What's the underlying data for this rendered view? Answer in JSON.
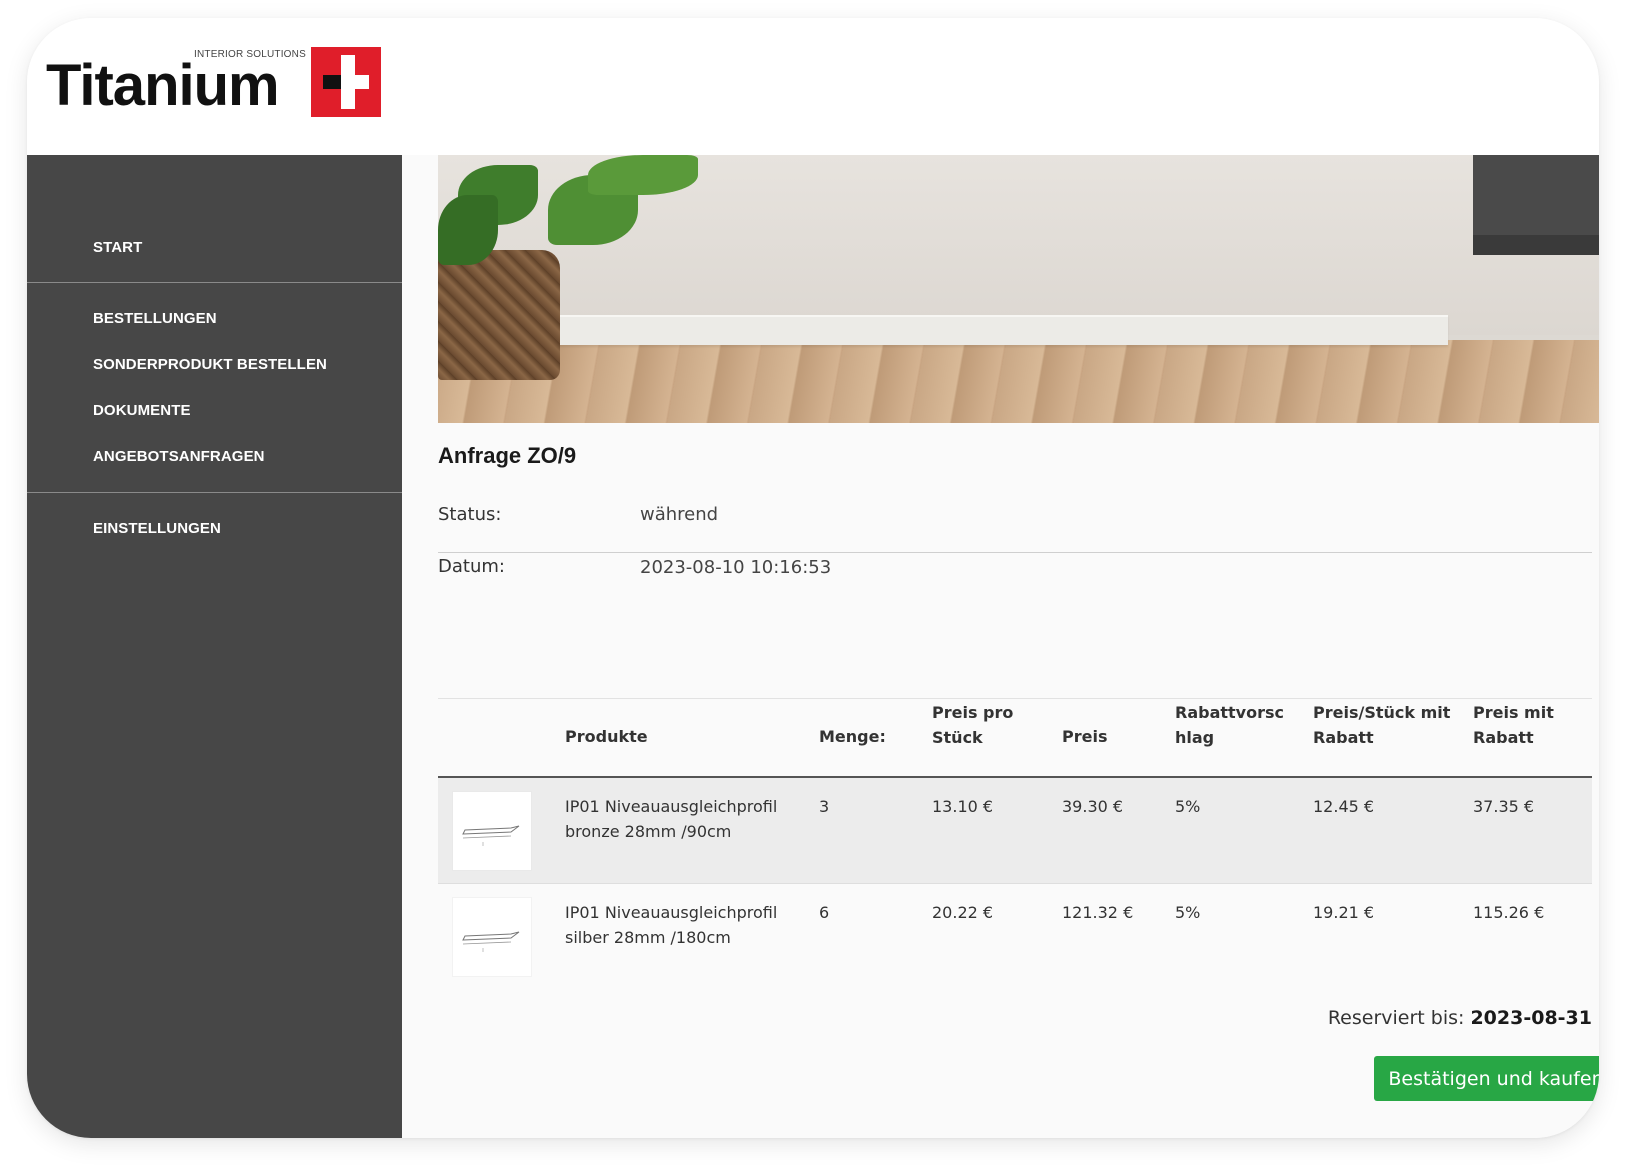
{
  "brand": {
    "name": "Titanium",
    "tagline": "INTERIOR SOLUTIONS",
    "accent": "#e01e2a"
  },
  "sidebar": {
    "items": [
      {
        "label": "START"
      },
      {
        "label": "BESTELLUNGEN"
      },
      {
        "label": "SONDERPRODUKT BESTELLEN"
      },
      {
        "label": "DOKUMENTE"
      },
      {
        "label": "ANGEBOTSANFRAGEN"
      },
      {
        "label": "EINSTELLUNGEN"
      }
    ]
  },
  "request": {
    "title": "Anfrage ZO/9",
    "status_label": "Status:",
    "status_value": "während",
    "date_label": "Datum:",
    "date_value": "2023-08-10 10:16:53"
  },
  "table": {
    "headers": {
      "product": "Produkte",
      "qty": "Menge:",
      "unit_price": "Preis pro Stück",
      "price": "Preis",
      "discount": "Rabattvorschlag",
      "unit_price_disc": "Preis/Stück mit Rabatt",
      "price_disc": "Preis mit Rabatt"
    },
    "rows": [
      {
        "product": "IP01 Niveauausgleichprofil bronze 28mm /90cm",
        "qty": "3",
        "unit_price": "13.10 €",
        "price": "39.30 €",
        "discount": "5%",
        "unit_price_disc": "12.45 €",
        "price_disc": "37.35 €"
      },
      {
        "product": "IP01 Niveauausgleichprofil silber 28mm /180cm",
        "qty": "6",
        "unit_price": "20.22 €",
        "price": "121.32 €",
        "discount": "5%",
        "unit_price_disc": "19.21 €",
        "price_disc": "115.26 €"
      }
    ]
  },
  "footer": {
    "reserved_label": "Reserviert bis:",
    "reserved_date": "2023-08-31",
    "buy_button": "Bestätigen und kaufen",
    "buy_color": "#28a745"
  }
}
